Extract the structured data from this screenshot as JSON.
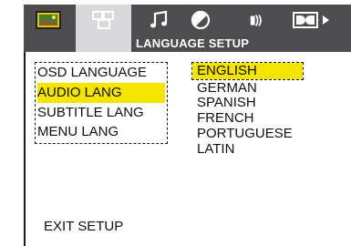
{
  "tabs": [
    {
      "icon": "tv-picture-icon",
      "active": false
    },
    {
      "icon": "language-setup-icon",
      "active": true
    },
    {
      "icon": "music-note-icon",
      "active": false
    },
    {
      "icon": "circle-slash-icon",
      "active": false
    },
    {
      "icon": "speaker-icon",
      "active": false
    },
    {
      "icon": "dolby-icon",
      "active": false
    }
  ],
  "speaker_label": "▮))",
  "title": "LANGUAGE SETUP",
  "menu": {
    "items": [
      "OSD LANGUAGE",
      "AUDIO LANG",
      "SUBTITLE LANG",
      "MENU LANG"
    ],
    "selected": "AUDIO LANG"
  },
  "options": {
    "items": [
      "ENGLISH",
      "GERMAN",
      "SPANISH",
      "FRENCH",
      "PORTUGUESE",
      "LATIN"
    ],
    "selected": "ENGLISH"
  },
  "exit_label": "EXIT SETUP",
  "colors": {
    "highlight": "#f5e400",
    "bar": "#4d4d4f",
    "active_tab": "#d9d9db"
  }
}
